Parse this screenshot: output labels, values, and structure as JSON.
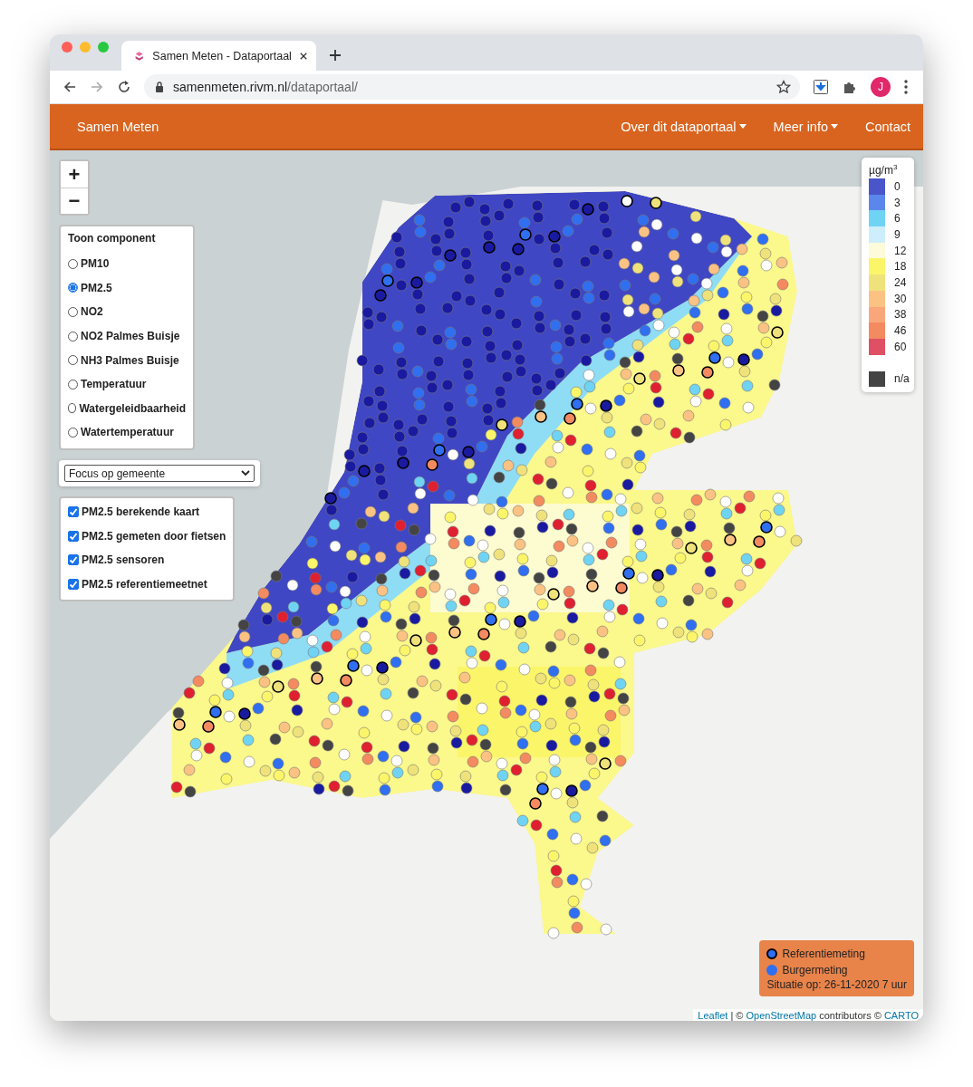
{
  "browser": {
    "tab": {
      "title": "Samen Meten - Dataportaal",
      "selected": true
    },
    "address": {
      "host": "samenmeten.rivm.nl",
      "path": "/dataportaal/"
    },
    "profile_initial": "J"
  },
  "navbar": {
    "brand": "Samen Meten",
    "items": [
      {
        "label": "Over dit dataportaal",
        "dropdown": true
      },
      {
        "label": "Meer info",
        "dropdown": true
      },
      {
        "label": "Contact",
        "dropdown": false
      }
    ]
  },
  "zoom": {
    "in": "+",
    "out": "−"
  },
  "component_panel": {
    "title": "Toon component",
    "options": [
      {
        "label": "PM10",
        "selected": false
      },
      {
        "label": "PM2.5",
        "selected": true
      },
      {
        "label": "NO2",
        "selected": false
      },
      {
        "label": "NO2 Palmes Buisje",
        "selected": false
      },
      {
        "label": "NH3 Palmes Buisje",
        "selected": false
      },
      {
        "label": "Temperatuur",
        "selected": false
      },
      {
        "label": "Watergeleidbaarheid",
        "selected": false
      },
      {
        "label": "Watertemperatuur",
        "selected": false
      }
    ]
  },
  "municipality_select": {
    "value": "Focus op gemeente"
  },
  "layers": [
    {
      "label": "PM2.5 berekende kaart",
      "checked": true
    },
    {
      "label": "PM2.5 gemeten door fietsen",
      "checked": true
    },
    {
      "label": "PM2.5 sensoren",
      "checked": true
    },
    {
      "label": "PM2.5 referentiemeetnet",
      "checked": true
    }
  ],
  "legend": {
    "unit": "µg/m",
    "unit_sup": "3",
    "steps": [
      {
        "label": "0",
        "color": "#4a55c9"
      },
      {
        "label": "3",
        "color": "#5b87ec"
      },
      {
        "label": "6",
        "color": "#6fd3f3"
      },
      {
        "label": "9",
        "color": "#cdeefa"
      },
      {
        "label": "12",
        "color": "#fdfbd9"
      },
      {
        "label": "18",
        "color": "#fbf56a"
      },
      {
        "label": "24",
        "color": "#efe27a"
      },
      {
        "label": "30",
        "color": "#fbc283"
      },
      {
        "label": "38",
        "color": "#f9a77a"
      },
      {
        "label": "46",
        "color": "#f48a60"
      },
      {
        "label": "60",
        "color": "#df5065"
      }
    ],
    "na": {
      "label": "n/a",
      "color": "#444444"
    }
  },
  "station_legend": {
    "items": [
      {
        "label": "Referentiemeting",
        "kind": "reference"
      },
      {
        "label": "Burgermeting",
        "kind": "citizen"
      }
    ],
    "situation": "Situatie op: 26-11-2020 7 uur"
  },
  "attribution": [
    {
      "text": "Leaflet",
      "kind": "link"
    },
    {
      "text": " | © ",
      "kind": "text"
    },
    {
      "text": "OpenStreetMap",
      "kind": "link"
    },
    {
      "text": " contributors © ",
      "kind": "text"
    },
    {
      "text": "CARTO",
      "kind": "link"
    }
  ]
}
